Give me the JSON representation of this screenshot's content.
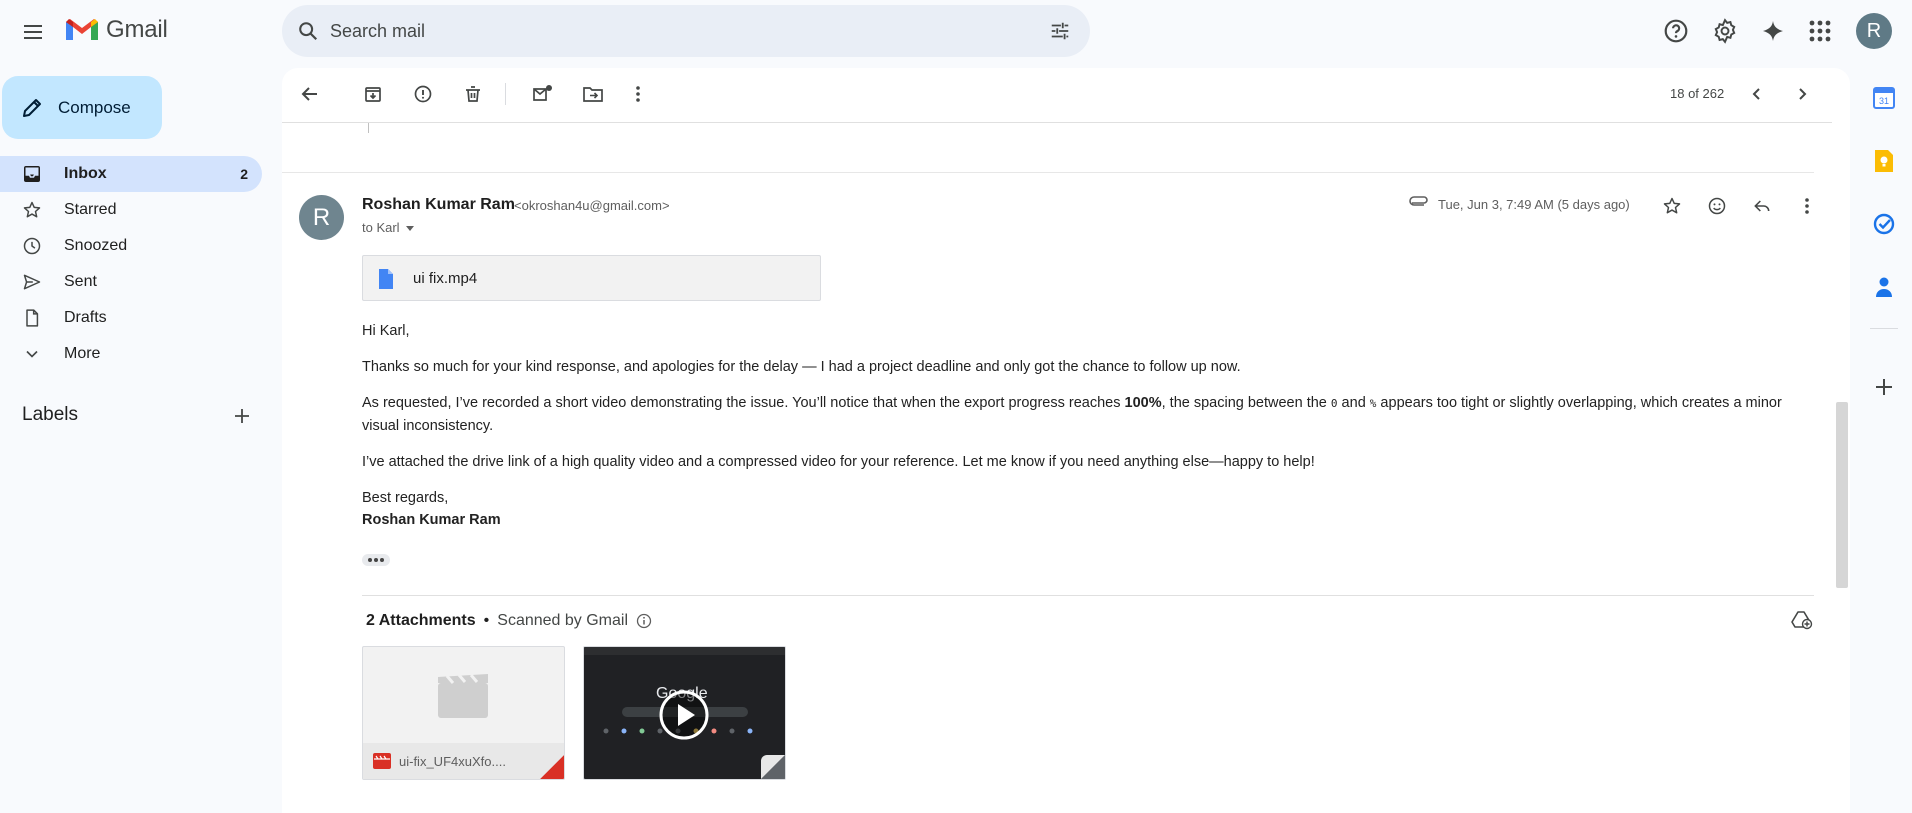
{
  "app": {
    "logo_text": "Gmail",
    "search_placeholder": "Search mail",
    "account_initial": "R"
  },
  "sidebar": {
    "compose_label": "Compose",
    "items": [
      {
        "label": "Inbox",
        "count": "2",
        "icon": "inbox-icon",
        "active": true
      },
      {
        "label": "Starred",
        "count": "",
        "icon": "star-icon"
      },
      {
        "label": "Snoozed",
        "count": "",
        "icon": "clock-icon"
      },
      {
        "label": "Sent",
        "count": "",
        "icon": "send-icon"
      },
      {
        "label": "Drafts",
        "count": "",
        "icon": "draft-icon"
      },
      {
        "label": "More",
        "count": "",
        "icon": "chevron-down-icon"
      }
    ],
    "labels_title": "Labels"
  },
  "toolbar": {
    "pager": "18 of 262"
  },
  "message": {
    "avatar_initial": "R",
    "sender_name": "Roshan Kumar Ram",
    "sender_email": "<okroshan4u@gmail.com>",
    "to": "to Karl",
    "date": "Tue, Jun 3, 7:49 AM (5 days ago)",
    "inline_attachment": "ui fix.mp4",
    "greeting": "Hi Karl,",
    "para1": "Thanks so much for your kind response, and apologies for the delay — I had a project deadline and only got the chance to follow up now.",
    "para2_a": "As requested, I’ve recorded a short video demonstrating the issue. You’ll notice that when the export progress reaches ",
    "para2_bold": "100%",
    "para2_b": ", the spacing between the ",
    "para2_code1": "0",
    "para2_c": " and ",
    "para2_code2": "%",
    "para2_d": " appears too tight or slightly overlapping, which creates a minor visual inconsistency.",
    "para3": "I’ve attached the drive link of a high quality video and a compressed video for your reference. Let me know if you need anything else—happy to help!",
    "signoff": "Best regards,",
    "signature": "Roshan Kumar Ram"
  },
  "attachments": {
    "count_label": "2 Attachments",
    "separator": "•",
    "scanned_label": "Scanned by Gmail",
    "file1_name": "ui-fix_UF4xuXfo....",
    "video_thumb_text": "Google"
  },
  "colors": {
    "compose_bg": "#c2e7ff",
    "active_nav_bg": "#d3e3fd",
    "search_bg": "#e9eef6"
  }
}
